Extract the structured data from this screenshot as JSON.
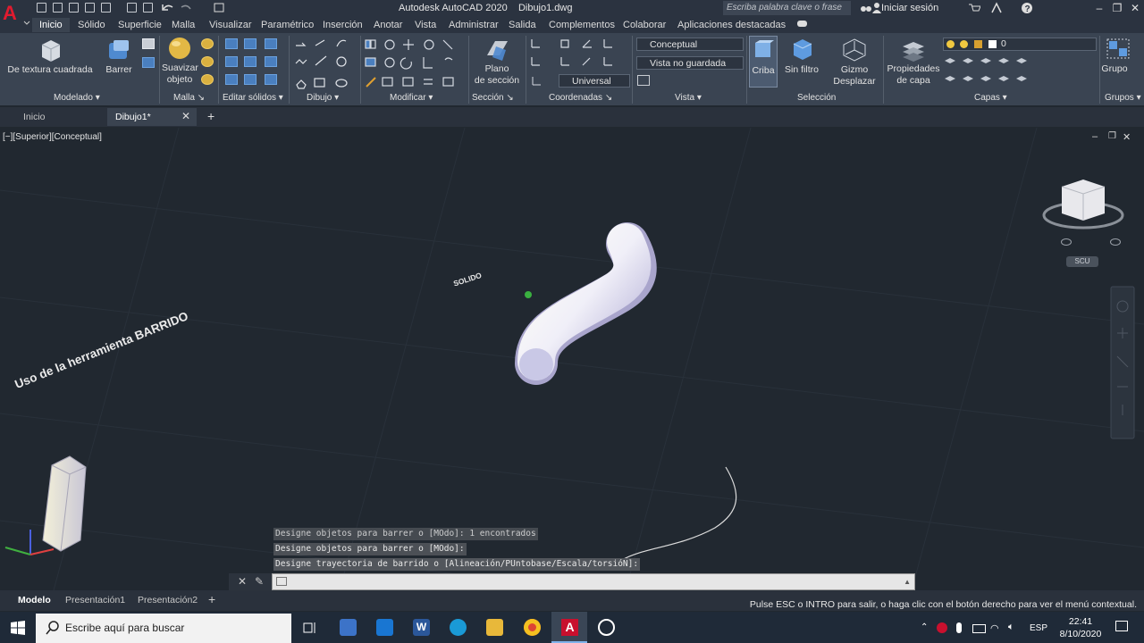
{
  "title_bar": {
    "app_name": "Autodesk AutoCAD 2020",
    "file_name": "Dibujo1.dwg",
    "search_placeholder": "Escriba palabra clave o frase",
    "signin_label": "Iniciar sesión"
  },
  "ribbon_tabs": [
    "Inicio",
    "Sólido",
    "Superficie",
    "Malla",
    "Visualizar",
    "Paramétrico",
    "Inserción",
    "Anotar",
    "Vista",
    "Administrar",
    "Salida",
    "Complementos",
    "Colaborar",
    "Aplicaciones destacadas"
  ],
  "ribbon": {
    "buttons": {
      "textura": "De textura cuadrada",
      "barrer": "Barrer",
      "suavizar_1": "Suavizar",
      "suavizar_2": "objeto",
      "plano_1": "Plano",
      "plano_2": "de sección",
      "criba": "Criba",
      "sin_filtro": "Sin filtro",
      "gizmo_1": "Gizmo",
      "gizmo_2": "Desplazar",
      "propiedades_1": "Propiedades",
      "propiedades_2": "de capa",
      "grupo": "Grupo"
    },
    "panels": {
      "modelado": "Modelado",
      "malla": "Malla",
      "editar_solidos": "Editar sólidos",
      "dibujo": "Dibujo",
      "modificar": "Modificar",
      "seccion": "Sección",
      "coordenadas": "Coordenadas",
      "vista": "Vista",
      "seleccion": "Selección",
      "capas": "Capas",
      "grupos": "Grupos"
    },
    "visual_style": "Conceptual",
    "view_state": "Vista no guardada",
    "ucs": "Universal",
    "layer_value": "0"
  },
  "file_tabs": {
    "home": "Inicio",
    "drawing": "Dibujo1*"
  },
  "viewport": {
    "label": "[−][Superior][Conceptual]",
    "text_solid": "SOLIDO",
    "text_title": "Uso de la herramienta BARRIDO",
    "ucs_badge": "SCU"
  },
  "command_history": [
    "Designe objetos para barrer o [MOdo]: 1 encontrados",
    "Designe objetos para barrer o [MOdo]:",
    "Designe trayectoria de barrido o [Alineación/PUntobase/Escala/torsióN]:"
  ],
  "layout_tabs": [
    "Modelo",
    "Presentación1",
    "Presentación2"
  ],
  "status_hint": "Pulse ESC o INTRO para salir, o haga clic con el botón derecho para ver el menú contextual.",
  "taskbar": {
    "search_placeholder": "Escribe aquí para buscar",
    "lang": "ESP",
    "time": "22:41",
    "date": "8/10/2020"
  },
  "colors": {
    "accent_autocad": "#c8102e",
    "ribbon_bg": "#3a4452",
    "viewport_bg": "#212830"
  }
}
